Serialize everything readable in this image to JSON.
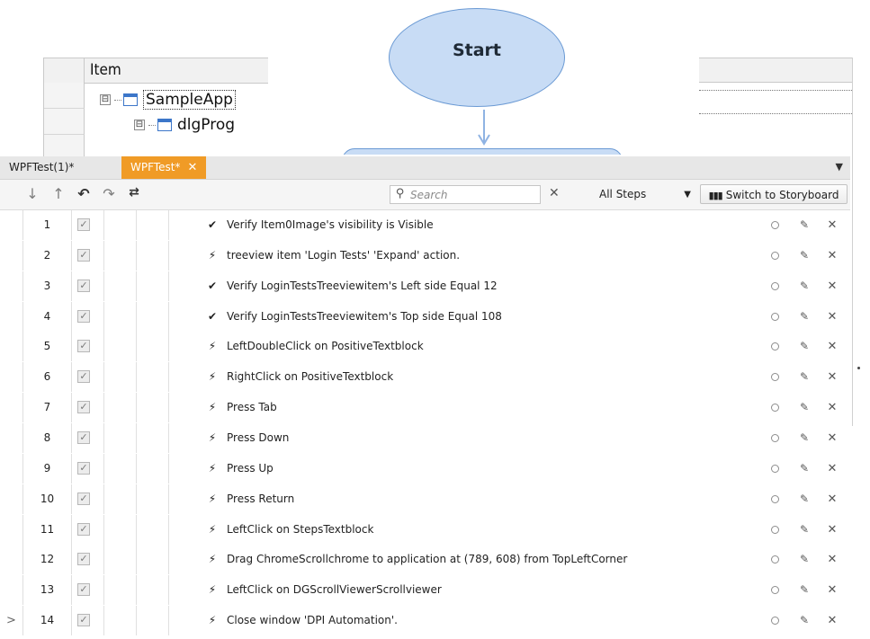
{
  "background_app": {
    "column_header": "Item",
    "tree": [
      {
        "label": "SampleApp",
        "expander": "⊟",
        "selected": true
      },
      {
        "label": "dlgProg",
        "expander": "⊟",
        "selected": false
      }
    ]
  },
  "flowchart": {
    "start_label": "Start",
    "colors": {
      "node_fill": "#c8dcf5",
      "node_border": "#6b9ad4"
    }
  },
  "editor": {
    "tabs": [
      {
        "label": "WPFTest(1)*",
        "active": false
      },
      {
        "label": "WPFTest*",
        "active": true,
        "close": "✕"
      }
    ],
    "tab_menu_icon": "▼",
    "toolbar": {
      "move_down": "↓",
      "move_up": "↑",
      "undo": "↶",
      "redo": "↷",
      "record": "⇄",
      "search_placeholder": "Search",
      "clear": "✕",
      "filter_value": "All Steps",
      "filter_caret": "▼",
      "storyboard_label": "Switch to Storyboard"
    },
    "accent_color": "#f09b26",
    "steps": [
      {
        "n": "1",
        "kind": "✔",
        "text": "Verify Item0Image's visibility is Visible",
        "cursor": ""
      },
      {
        "n": "2",
        "kind": "⚡",
        "text": "treeview item 'Login Tests' 'Expand' action.",
        "cursor": ""
      },
      {
        "n": "3",
        "kind": "✔",
        "text": "Verify LoginTestsTreeviewitem's Left side Equal 12",
        "cursor": ""
      },
      {
        "n": "4",
        "kind": "✔",
        "text": "Verify LoginTestsTreeviewitem's Top side Equal 108",
        "cursor": ""
      },
      {
        "n": "5",
        "kind": "⚡",
        "text": "LeftDoubleClick on PositiveTextblock",
        "cursor": ""
      },
      {
        "n": "6",
        "kind": "⚡",
        "text": "RightClick on PositiveTextblock",
        "cursor": ""
      },
      {
        "n": "7",
        "kind": "⚡",
        "text": "Press Tab",
        "cursor": ""
      },
      {
        "n": "8",
        "kind": "⚡",
        "text": "Press Down",
        "cursor": ""
      },
      {
        "n": "9",
        "kind": "⚡",
        "text": "Press Up",
        "cursor": ""
      },
      {
        "n": "10",
        "kind": "⚡",
        "text": "Press Return",
        "cursor": ""
      },
      {
        "n": "11",
        "kind": "⚡",
        "text": "LeftClick on StepsTextblock",
        "cursor": ""
      },
      {
        "n": "12",
        "kind": "⚡",
        "text": "Drag ChromeScrollchrome to application at (789, 608) from TopLeftCorner",
        "cursor": ""
      },
      {
        "n": "13",
        "kind": "⚡",
        "text": "LeftClick on DGScrollViewerScrollviewer",
        "cursor": ""
      },
      {
        "n": "14",
        "kind": "⚡",
        "text": "Close window 'DPI Automation'.",
        "cursor": ">"
      }
    ],
    "row_actions": {
      "edit": "✎",
      "delete": "✕",
      "checkbox": "✓"
    }
  }
}
